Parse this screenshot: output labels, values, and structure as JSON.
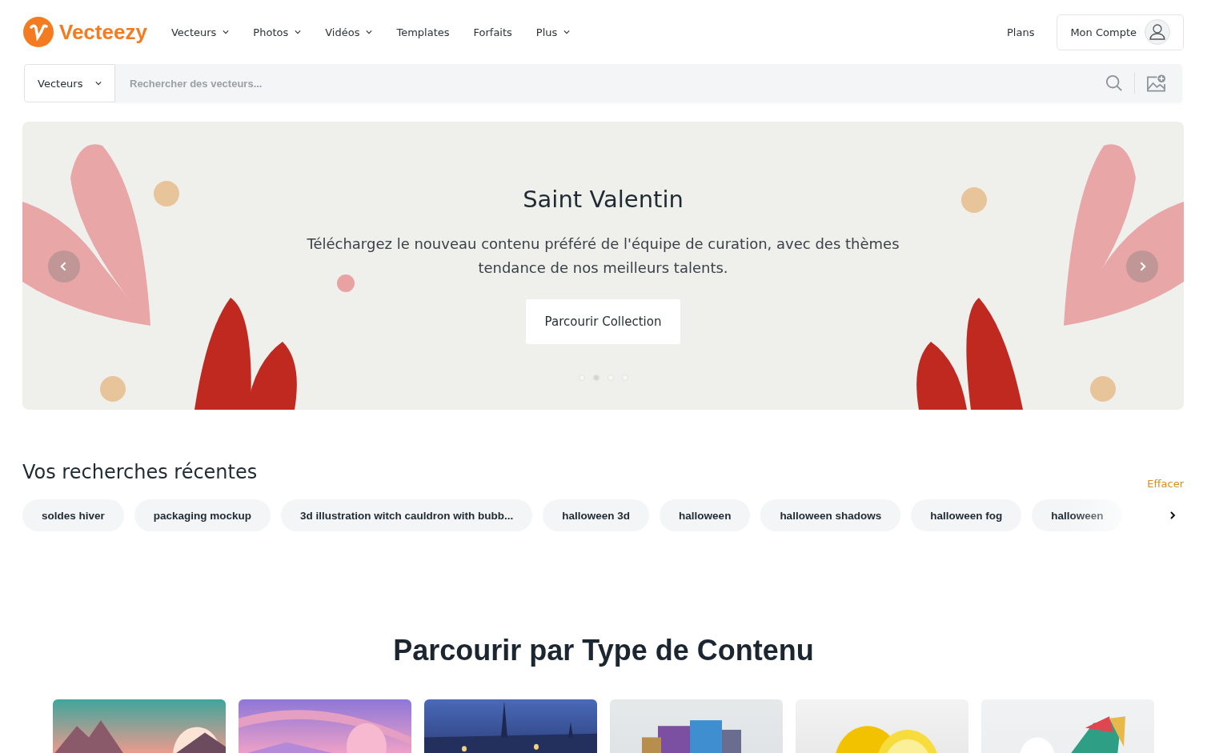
{
  "brand": {
    "name": "Vecteezy"
  },
  "nav": [
    {
      "label": "Vecteurs",
      "has_menu": true
    },
    {
      "label": "Photos",
      "has_menu": true
    },
    {
      "label": "Vidéos",
      "has_menu": true
    },
    {
      "label": "Templates",
      "has_menu": false
    },
    {
      "label": "Forfaits",
      "has_menu": false
    },
    {
      "label": "Plus",
      "has_menu": true
    }
  ],
  "header_right": {
    "plans": "Plans",
    "account": "Mon Compte"
  },
  "search": {
    "category": "Vecteurs",
    "placeholder": "Rechercher des vecteurs..."
  },
  "hero": {
    "title": "Saint Valentin",
    "text": "Téléchargez le nouveau contenu préféré de l'équipe de curation, avec des thèmes tendance de nos meilleurs talents.",
    "button": "Parcourir Collection",
    "dots": [
      {
        "selected": false
      },
      {
        "selected": true
      },
      {
        "selected": false
      },
      {
        "selected": false
      }
    ]
  },
  "recent": {
    "title": "Vos recherches récentes",
    "clear": "Effacer",
    "chips": [
      "soldes hiver",
      "packaging mockup",
      "3d illustration witch cauldron with bubb...",
      "halloween 3d",
      "halloween",
      "halloween shadows",
      "halloween fog",
      "halloween"
    ]
  },
  "content_types": {
    "title": "Parcourir par Type de Contenu"
  }
}
